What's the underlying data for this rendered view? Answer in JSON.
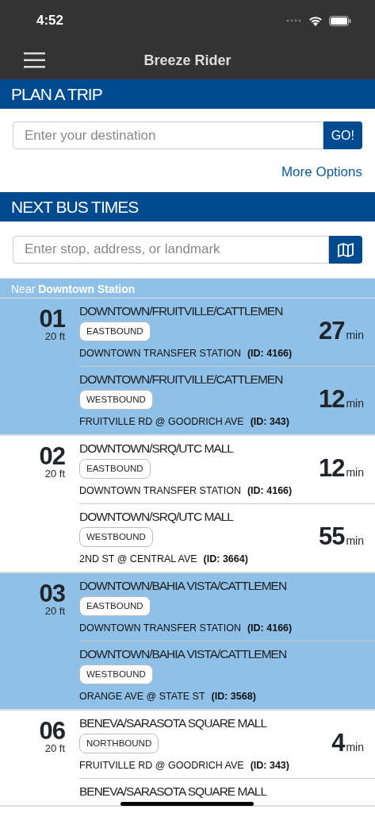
{
  "status_bar": {
    "time": "4:52"
  },
  "header": {
    "title": "Breeze Rider"
  },
  "plan_trip": {
    "heading": "PLAN A TRIP",
    "destination": {
      "placeholder": "Enter your destination"
    },
    "go_button": "GO!",
    "more_options": "More Options"
  },
  "next_bus": {
    "heading": "NEXT BUS TIMES",
    "search": {
      "placeholder": "Enter stop, address, or landmark"
    },
    "near_label": "Near **Downtown Station**",
    "routes": [
      {
        "number": "01",
        "distance": "20 ft",
        "trips": [
          {
            "route": "DOWNTOWN/FRUITVILLE/CATTLEMEN",
            "direction": "EASTBOUND",
            "stop": "DOWNTOWN TRANSFER STATION",
            "stop_id": "(ID: 4166)",
            "minutes": "27",
            "unit": "min"
          },
          {
            "route": "DOWNTOWN/FRUITVILLE/CATTLEMEN",
            "direction": "WESTBOUND",
            "stop": "FRUITVILLE RD @ GOODRICH AVE",
            "stop_id": "(ID: 343)",
            "minutes": "12",
            "unit": "min"
          }
        ]
      },
      {
        "number": "02",
        "distance": "20 ft",
        "trips": [
          {
            "route": "DOWNTOWN/SRQ/UTC MALL",
            "direction": "EASTBOUND",
            "stop": "DOWNTOWN TRANSFER STATION",
            "stop_id": "(ID: 4166)",
            "minutes": "12",
            "unit": "min"
          },
          {
            "route": "DOWNTOWN/SRQ/UTC MALL",
            "direction": "WESTBOUND",
            "stop": "2ND ST @ CENTRAL AVE",
            "stop_id": "(ID: 3664)",
            "minutes": "55",
            "unit": "min"
          }
        ]
      },
      {
        "number": "03",
        "distance": "20 ft",
        "trips": [
          {
            "route": "DOWNTOWN/BAHIA VISTA/CATTLEMEN",
            "direction": "EASTBOUND",
            "stop": "DOWNTOWN TRANSFER STATION",
            "stop_id": "(ID: 4166)"
          },
          {
            "route": "DOWNTOWN/BAHIA VISTA/CATTLEMEN",
            "direction": "WESTBOUND",
            "stop": "ORANGE AVE @ STATE ST",
            "stop_id": "(ID: 3568)"
          }
        ]
      },
      {
        "number": "06",
        "distance": "20 ft",
        "trips": [
          {
            "route": "BENEVA/SARASOTA SQUARE MALL",
            "direction": "NORTHBOUND",
            "stop": "FRUITVILLE RD @ GOODRICH AVE",
            "stop_id": "(ID: 343)",
            "minutes": "4",
            "unit": "min"
          },
          {
            "route": "BENEVA/SARASOTA SQUARE MALL"
          }
        ]
      }
    ]
  }
}
